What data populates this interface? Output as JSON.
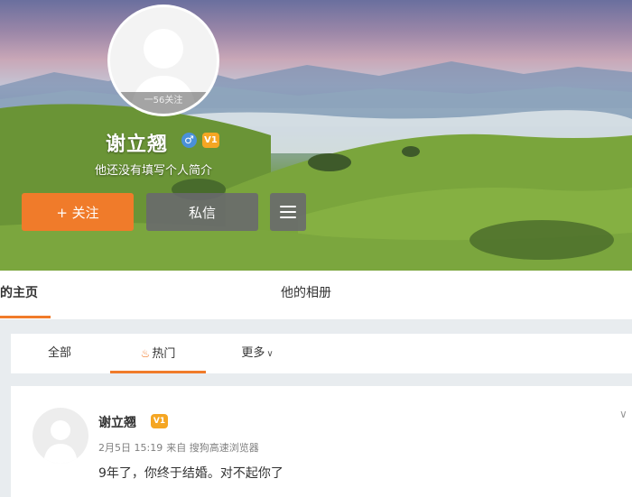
{
  "profile": {
    "avatar_badge": "一56关注",
    "username": "谢立翘",
    "gender_icon": "male-icon",
    "vip_label": "V1",
    "bio": "他还没有填写个人简介",
    "follow_label": "+ 关注",
    "message_label": "私信",
    "menu_icon": "menu-icon"
  },
  "nav": {
    "home_label": "的主页",
    "album_label": "他的相册"
  },
  "feed_filter": {
    "all_label": "全部",
    "hot_label": "热门",
    "more_label": "更多",
    "active": "hot"
  },
  "post": {
    "name": "谢立翘",
    "vip_label": "V1",
    "date": "2月5日 15:19",
    "source": "来自 搜狗高速浏览器",
    "text": "9年了，你终于结婚。对不起你了"
  },
  "colors": {
    "accent": "#f07b2a",
    "vip": "#f5a623",
    "gender": "#4a90d9"
  }
}
